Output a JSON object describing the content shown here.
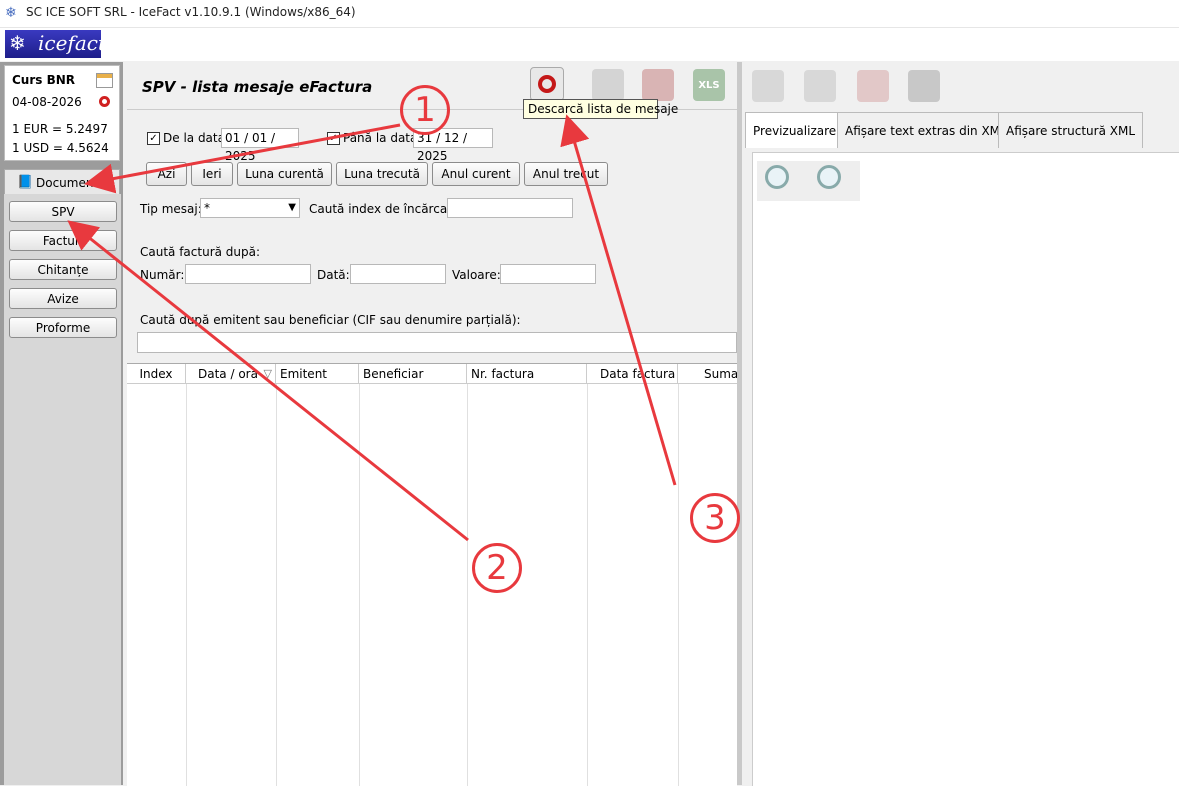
{
  "window": {
    "title": "SC ICE SOFT SRL - IceFact v1.10.9.1 (Windows/x86_64)"
  },
  "logo": {
    "text": "icefact"
  },
  "bnr": {
    "title": "Curs BNR",
    "date": "04-08-2026",
    "eur": "1 EUR = 5.2497",
    "usd": "1 USD = 4.5624"
  },
  "sidebar": {
    "documents_tab": "Documente",
    "items": [
      {
        "label": "SPV"
      },
      {
        "label": "Facturi"
      },
      {
        "label": "Chitanțe"
      },
      {
        "label": "Avize"
      },
      {
        "label": "Proforme"
      }
    ]
  },
  "spv": {
    "title": "SPV - lista mesaje eFactura",
    "tooltip": "Descarcă lista de mesaje",
    "from_label": "De la data",
    "from_date": "01 / 01 / 2025",
    "to_label": "Până la data",
    "to_date": "31 / 12 / 2025",
    "quick_ranges": [
      "Azi",
      "Ieri",
      "Luna curentă",
      "Luna trecută",
      "Anul curent",
      "Anul trecut"
    ],
    "tip_mesaj_label": "Tip mesaj:",
    "tip_mesaj_value": "*",
    "index_label": "Caută index de încărcare:",
    "search_invoice_label": "Caută factură după:",
    "numar_label": "Număr:",
    "data_label": "Dată:",
    "valoare_label": "Valoare:",
    "emitent_search_label": "Caută după emitent sau beneficiar (CIF sau denumire parțială):",
    "columns": [
      "Index",
      "Data / ora",
      "Emitent",
      "Beneficiar",
      "Nr. factura",
      "Data factura",
      "Suma"
    ],
    "xls_icon_text": "XLS"
  },
  "right_panel": {
    "tabs": [
      "Previzualizare",
      "Afișare text extras din XML",
      "Afișare structură XML"
    ]
  },
  "annotations": {
    "one": "1",
    "two": "2",
    "three": "3"
  },
  "colors": {
    "annotation": "#e8393e",
    "logo_bg": "#2a2aa8",
    "sidebar_bg": "#9c9c9c"
  }
}
